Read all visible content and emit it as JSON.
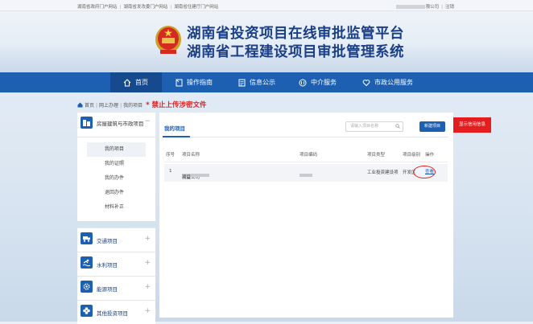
{
  "topbar": {
    "links": [
      "湖南省政府门户网站",
      "湖南省发改委门户网站",
      "湖南省住建厅门户网站"
    ],
    "company_suffix": "限公司",
    "logout": "注销"
  },
  "header": {
    "title_line1": "湖南省投资项目在线审批监管平台",
    "title_line2": "湖南省工程建设项目审批管理系统"
  },
  "nav": {
    "items": [
      {
        "label": "首页",
        "icon": "home-icon"
      },
      {
        "label": "操作指南",
        "icon": "guide-icon"
      },
      {
        "label": "信息公示",
        "icon": "notice-icon"
      },
      {
        "label": "中介服务",
        "icon": "agency-icon"
      },
      {
        "label": "市政公用服务",
        "icon": "heart-icon"
      }
    ]
  },
  "breadcrumb": {
    "items": [
      "首页",
      "网上办理",
      "我的项目"
    ],
    "warning": "* 禁止上传涉密文件"
  },
  "sidebar": {
    "head_label": "房屋建筑与市政项目",
    "sub_items": [
      "我的项目",
      "我的证照",
      "我的办件",
      "退回办件",
      "材料补正"
    ],
    "groups": [
      "交通项目",
      "水利项目",
      "能源项目",
      "其他投资项目"
    ]
  },
  "main": {
    "tab": "我的项目",
    "search_placeholder": "请输入项目名称",
    "new_button": "新建项目",
    "columns": [
      "序号",
      "项目名称",
      "项目编码",
      "项目类型",
      "项目级别",
      "操作"
    ],
    "rows": [
      {
        "index": "1",
        "name_suffix": "房屋公司",
        "name_tail": "项目",
        "code_prefix": "217",
        "code_mid": "-04-0",
        "type": "工业投资建设项",
        "level": "开发区",
        "action": "查看"
      }
    ]
  },
  "credit_button": "显示信用信息",
  "colors": {
    "nav_bg": "#1d5fb0",
    "title": "#1a3f86",
    "warning": "#e0201f",
    "credit": "#e41e1e"
  }
}
